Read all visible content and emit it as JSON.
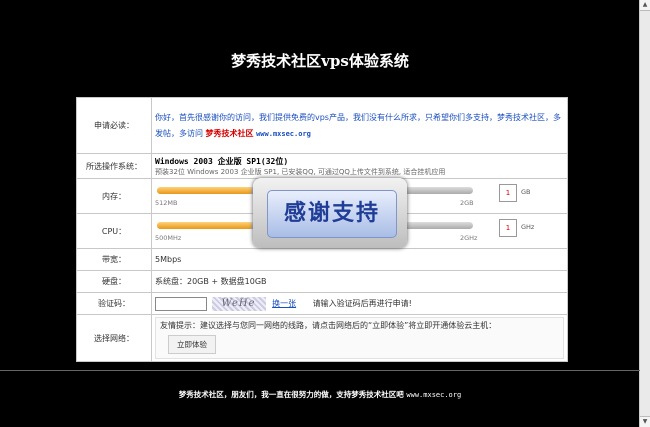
{
  "page": {
    "title": "梦秀技术社区vps体验系统"
  },
  "form": {
    "notice_label": "申请必读：",
    "notice_text": "你好，首先很感谢你的访问，我们提供免费的vps产品，我们没有什么所求，只希望你们多支持，梦秀技术社区，多发帖，多访问",
    "notice_brand": "梦秀技术社区",
    "notice_url": "www.mxsec.org",
    "os_label": "所选操作系统：",
    "os_title": "Windows 2003 企业版 SP1(32位)",
    "os_desc": "预装32位 Windows 2003 企业版 SP1, 已安装QQ, 可通过QQ上传文件到系统, 适合挂机应用",
    "memory": {
      "label": "内存：",
      "min": "512MB",
      "max": "2GB",
      "value": "1",
      "unit": "GB",
      "level": 0.3
    },
    "cpu": {
      "label": "CPU：",
      "min": "500MHz",
      "max": "2GHz",
      "value": "1",
      "unit": "GHz",
      "level": 0.3
    },
    "bandwidth_label": "带宽：",
    "bandwidth_value": "5Mbps",
    "disk_label": "硬盘：",
    "disk_value": "系统盘：20GB + 数据盘10GB",
    "captcha_label": "验证码：",
    "captcha_image_text": "WeHe",
    "captcha_refresh": "换一张",
    "captcha_tip": "请输入验证码后再进行申请!",
    "network_label": "选择网络：",
    "network_tip": "友情提示：建议选择与您同一网络的线路，请点击网络后的“立即体验”将立即开通体验云主机：",
    "start_button": "立即体验"
  },
  "overlay": {
    "text": "感谢支持"
  },
  "footer": {
    "text": "梦秀技术社区，朋友们，我一直在很努力的做，支持梦秀技术社区吧",
    "url": "www.mxsec.org"
  }
}
